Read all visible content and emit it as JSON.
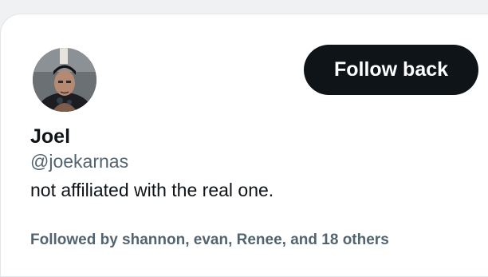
{
  "profile": {
    "name": "Joel",
    "handle": "@joekarnas",
    "bio": "not affiliated with the real one.",
    "followed_by": "Followed by shannon, evan, Renee, and 18 others",
    "avatar_icon": "user-avatar-photo"
  },
  "actions": {
    "follow_label": "Follow back"
  },
  "colors": {
    "primary_text": "#0f1419",
    "secondary_text": "#536471",
    "button_bg": "#0f1419",
    "button_text": "#ffffff",
    "card_bg": "#ffffff",
    "page_bg": "#eff1f3"
  }
}
